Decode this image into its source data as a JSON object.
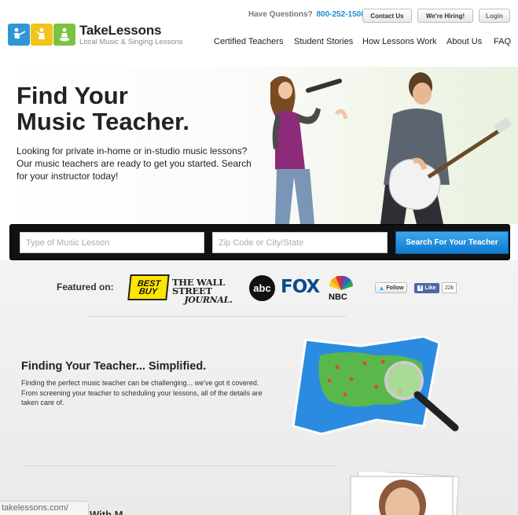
{
  "header": {
    "logo": {
      "name": "TakeLessons",
      "tagline": "Local Music & Singing Lessons"
    },
    "questions_label": "Have Questions?",
    "phone": "800-252-1508",
    "buttons": {
      "contact": "Contact Us",
      "hiring": "We're Hiring!",
      "login": "Login"
    },
    "nav": [
      "Certified Teachers",
      "Student Stories",
      "How Lessons Work",
      "About Us",
      "FAQ"
    ]
  },
  "hero": {
    "title_line1": "Find Your",
    "title_line2": "Music Teacher.",
    "subtitle": "Looking for private in-home or in-studio music lessons? Our music teachers are ready to get you started. Search for your instructor today!"
  },
  "search": {
    "lesson_placeholder": "Type of Music Lesson",
    "location_placeholder": "Zip Code or City/State",
    "button": "Search For Your Teacher"
  },
  "featured": {
    "label": "Featured on:",
    "logos": {
      "bestbuy": "BEST BUY",
      "wsj_line1": "THE WALL STREET",
      "wsj_line2": "JOURNAL.",
      "abc": "abc",
      "fox": "FOX",
      "nbc": "NBC"
    }
  },
  "social": {
    "twitter": "Follow",
    "facebook": "Like",
    "facebook_count": "22k"
  },
  "simplified": {
    "title": "Finding Your Teacher... Simplified.",
    "text": "Finding the perfect music teacher can be challenging... we've got it covered. From screening your teacher to scheduling your lessons, all of the details are taken care of."
  },
  "status_url": "takelessons.com/",
  "next_section_peek": "With M",
  "colors": {
    "accent_blue": "#1b8bd3",
    "search_bar": "#111111",
    "button_blue": "#1a86d8"
  }
}
